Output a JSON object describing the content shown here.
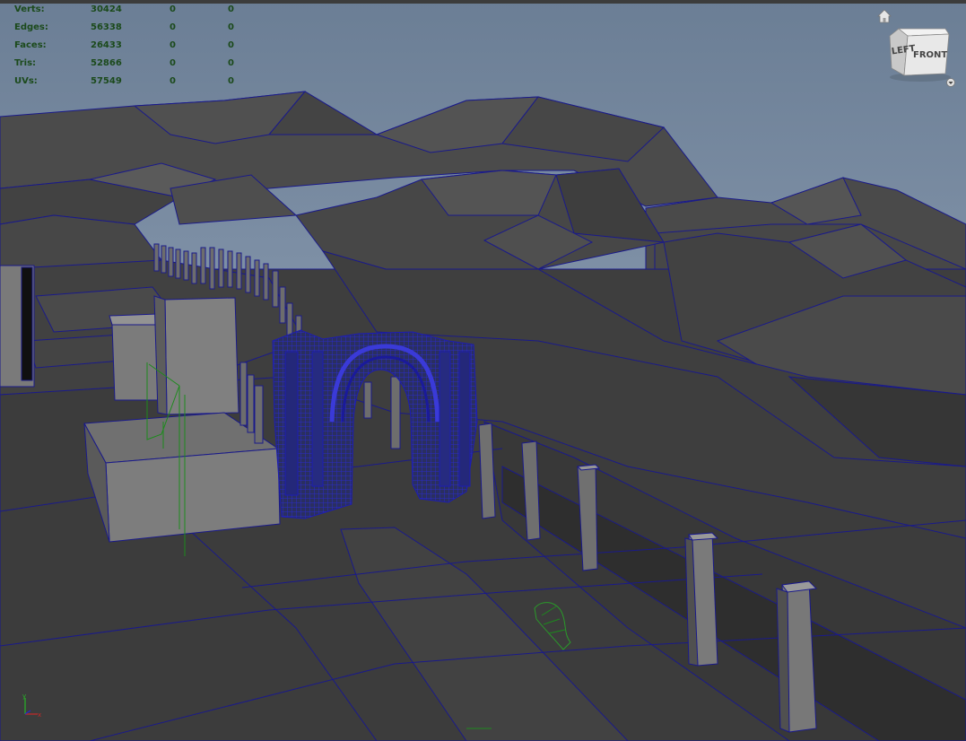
{
  "hud": {
    "rows": [
      {
        "label": "Verts:",
        "value": "30424",
        "v2": "0",
        "v3": "0"
      },
      {
        "label": "Edges:",
        "value": "56338",
        "v2": "0",
        "v3": "0"
      },
      {
        "label": "Faces:",
        "value": "26433",
        "v2": "0",
        "v3": "0"
      },
      {
        "label": "Tris:",
        "value": "52866",
        "v2": "0",
        "v3": "0"
      },
      {
        "label": "UVs:",
        "value": "57549",
        "v2": "0",
        "v3": "0"
      }
    ]
  },
  "viewcube": {
    "front_label": "FRONT",
    "left_label": "LEFT"
  },
  "axis": {
    "y_label": "y",
    "x_label": "x"
  },
  "icons": {
    "home": "home-icon",
    "cube_menu": "chevron-down-icon"
  },
  "colors": {
    "hud_text": "#1b4a1b",
    "wireframe": "#1a1a8a",
    "selection": "#1f1fa8",
    "sky_top": "#6c7f96",
    "sky_bottom": "#9aaabe",
    "ground": "#3d3d3d"
  }
}
